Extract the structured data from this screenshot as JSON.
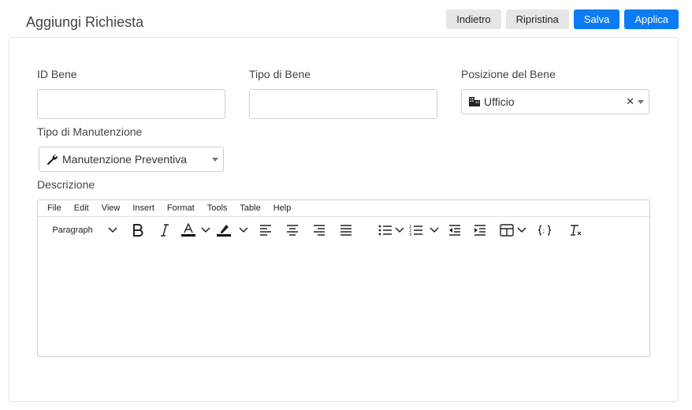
{
  "page": {
    "title": "Aggiungi Richiesta"
  },
  "actions": {
    "back": "Indietro",
    "reset": "Ripristina",
    "save": "Salva",
    "apply": "Applica"
  },
  "form": {
    "asset_id": {
      "label": "ID Bene",
      "value": ""
    },
    "asset_type": {
      "label": "Tipo di Bene",
      "value": ""
    },
    "asset_location": {
      "label": "Posizione del Bene",
      "value": "Ufficio",
      "icon": "office-building-icon"
    },
    "maintenance_type": {
      "label": "Tipo di Manutenzione",
      "value": "Manutenzione Preventiva",
      "icon": "wrench-icon"
    },
    "description": {
      "label": "Descrizione"
    }
  },
  "editor": {
    "menu": [
      "File",
      "Edit",
      "View",
      "Insert",
      "Format",
      "Tools",
      "Table",
      "Help"
    ],
    "block_format": "Paragraph"
  },
  "colors": {
    "primary": "#0d7bf2",
    "secondary": "#e6e6e6"
  }
}
